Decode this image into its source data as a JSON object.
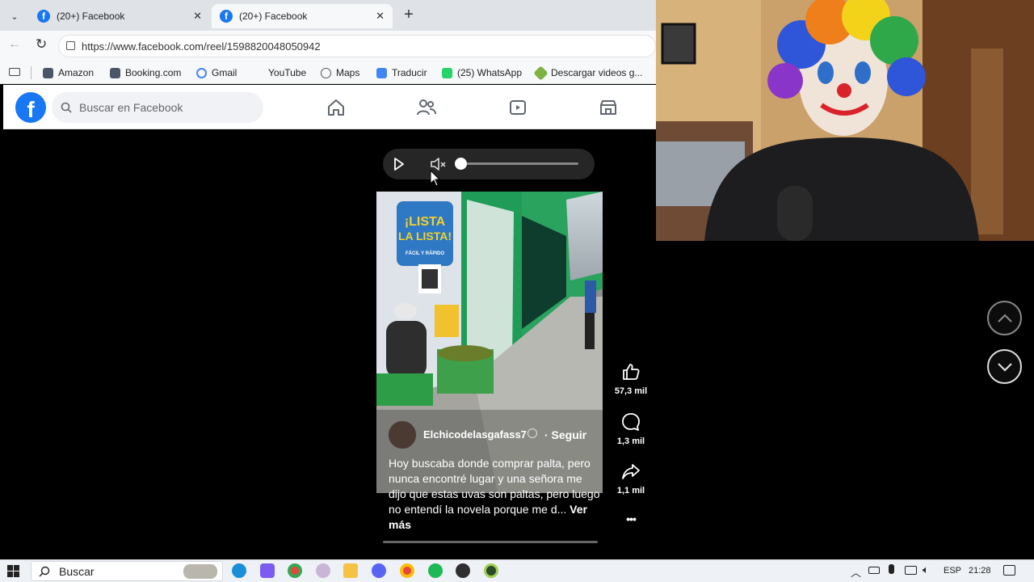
{
  "browser": {
    "tabs": [
      {
        "label": "(20+) Facebook",
        "active": false
      },
      {
        "label": "(20+) Facebook",
        "active": true
      }
    ],
    "new_tab_symbol": "+",
    "url": "https://www.facebook.com/reel/1598820048050942",
    "bookmarks": [
      {
        "label": "Amazon",
        "color": "#4a5568"
      },
      {
        "label": "Booking.com",
        "color": "#4a5568"
      },
      {
        "label": "Gmail",
        "color": "#4285f4"
      },
      {
        "label": "YouTube",
        "color": "#ffffff"
      },
      {
        "label": "Maps",
        "color": "#555555"
      },
      {
        "label": "Traducir",
        "color": "#4285f4"
      },
      {
        "label": "(25) WhatsApp",
        "color": "#25d366"
      },
      {
        "label": "Descargar videos g...",
        "color": "#7cb342"
      }
    ]
  },
  "facebook": {
    "search_placeholder": "Buscar en Facebook",
    "brand_color": "#1877f2",
    "nav_icons": [
      "home-icon",
      "friends-icon",
      "watch-icon",
      "marketplace-icon"
    ]
  },
  "reel": {
    "volume_level": 0,
    "video_sign_lines": [
      "¡LISTA",
      "LA LISTA!",
      "FÁCIL Y RÁPIDO"
    ],
    "author": "Elchicodelasgafass7",
    "follow_label": "· Seguir",
    "caption": "Hoy buscaba donde comprar palta, pero nunca encontré lugar y una señora me dijo que estas uvas son paltas, pero luego no entendí la novela porque me d...",
    "see_more": "Ver más",
    "likes": "57,3 mil",
    "comments": "1,3 mil",
    "shares": "1,1 mil",
    "more_label": "•••"
  },
  "taskbar": {
    "search_label": "Buscar",
    "language": "ESP",
    "time": "21:28",
    "apps": [
      "edge-icon",
      "copilot-icon",
      "chrome-icon",
      "app-icon",
      "files-icon",
      "discord-icon",
      "chrome-icon",
      "spotify-icon",
      "obs-icon",
      "app-icon"
    ]
  }
}
